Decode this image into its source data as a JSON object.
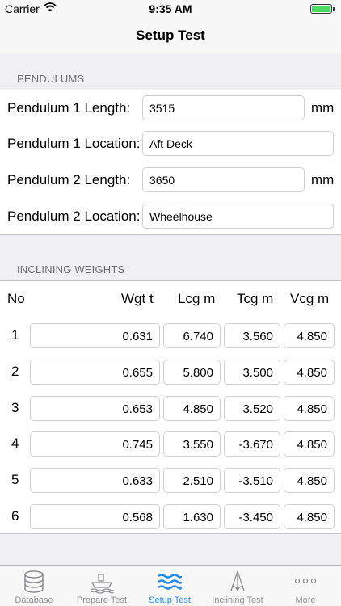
{
  "status": {
    "carrier": "Carrier",
    "time": "9:35 AM"
  },
  "nav": {
    "title": "Setup Test"
  },
  "pendulums": {
    "header": "PENDULUMS",
    "rows": [
      {
        "label": "Pendulum 1 Length:",
        "value": "3515",
        "unit": "mm"
      },
      {
        "label": "Pendulum 1 Location:",
        "value": "Aft Deck"
      },
      {
        "label": "Pendulum 2 Length:",
        "value": "3650",
        "unit": "mm"
      },
      {
        "label": "Pendulum 2 Location:",
        "value": "Wheelhouse"
      }
    ]
  },
  "weights": {
    "header": "INCLINING WEIGHTS",
    "columns": [
      "No",
      "Wgt t",
      "Lcg m",
      "Tcg m",
      "Vcg m"
    ],
    "rows": [
      {
        "no": "1",
        "wgt": "0.631",
        "lcg": "6.740",
        "tcg": "3.560",
        "vcg": "4.850"
      },
      {
        "no": "2",
        "wgt": "0.655",
        "lcg": "5.800",
        "tcg": "3.500",
        "vcg": "4.850"
      },
      {
        "no": "3",
        "wgt": "0.653",
        "lcg": "4.850",
        "tcg": "3.520",
        "vcg": "4.850"
      },
      {
        "no": "4",
        "wgt": "0.745",
        "lcg": "3.550",
        "tcg": "-3.670",
        "vcg": "4.850"
      },
      {
        "no": "5",
        "wgt": "0.633",
        "lcg": "2.510",
        "tcg": "-3.510",
        "vcg": "4.850"
      },
      {
        "no": "6",
        "wgt": "0.568",
        "lcg": "1.630",
        "tcg": "-3.450",
        "vcg": "4.850"
      }
    ]
  },
  "tabs": [
    {
      "label": "Database",
      "icon": "database-icon"
    },
    {
      "label": "Prepare Test",
      "icon": "ship-icon"
    },
    {
      "label": "Setup Test",
      "icon": "waves-icon",
      "active": true
    },
    {
      "label": "Inclining Test",
      "icon": "pendulum-icon"
    },
    {
      "label": "More",
      "icon": "more-icon"
    }
  ],
  "colors": {
    "accent": "#1f8cf0",
    "battery": "#4cd964",
    "inactive": "#8e8e93"
  }
}
